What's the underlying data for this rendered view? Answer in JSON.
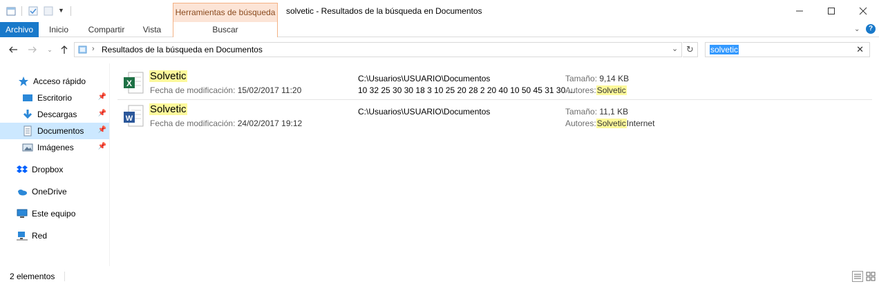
{
  "window": {
    "title": "solvetic - Resultados de la búsqueda en Documentos",
    "contextual_tab_group": "Herramientas de búsqueda"
  },
  "ribbon": {
    "tabs": [
      "Archivo",
      "Inicio",
      "Compartir",
      "Vista",
      "Buscar"
    ]
  },
  "address": {
    "path": "Resultados de la búsqueda en Documentos",
    "search_value": "solvetic"
  },
  "nav": {
    "items": [
      {
        "label": "Acceso rápido",
        "icon": "star-icon"
      },
      {
        "label": "Escritorio",
        "icon": "desktop-icon",
        "pinned": true
      },
      {
        "label": "Descargas",
        "icon": "download-icon",
        "pinned": true
      },
      {
        "label": "Documentos",
        "icon": "documents-icon",
        "pinned": true,
        "selected": true
      },
      {
        "label": "Imágenes",
        "icon": "pictures-icon",
        "pinned": true
      },
      {
        "label": "Dropbox",
        "icon": "dropbox-icon"
      },
      {
        "label": "OneDrive",
        "icon": "onedrive-icon"
      },
      {
        "label": "Este equipo",
        "icon": "computer-icon"
      },
      {
        "label": "Red",
        "icon": "network-icon"
      }
    ]
  },
  "results": [
    {
      "name": "Solvetic",
      "type_icon": "excel-file-icon",
      "modified_label": "Fecha de modificación:",
      "modified": "15/02/2017 11:20",
      "folder": "C:\\Usuarios\\USUARIO\\Documentos",
      "preview": "10 32 25 30 30 18 3 10 25 20 28 2 20 40 10 50 45 31 30 ...",
      "size_label": "Tamaño:",
      "size": "9,14 KB",
      "authors_label": "Autores:",
      "authors_highlight": "Solvetic",
      "authors_rest": ""
    },
    {
      "name": "Solvetic",
      "type_icon": "word-file-icon",
      "modified_label": "Fecha de modificación:",
      "modified": "24/02/2017 19:12",
      "folder": "C:\\Usuarios\\USUARIO\\Documentos",
      "preview": "",
      "size_label": "Tamaño:",
      "size": "11,1 KB",
      "authors_label": "Autores:",
      "authors_highlight": "Solvetic",
      "authors_rest": "Internet"
    }
  ],
  "status": {
    "count": "2 elementos"
  },
  "colors": {
    "file_tab": "#1979ca",
    "contextual_tab": "#fce4d6",
    "highlight": "#fdf99b",
    "selection": "#cce8ff"
  }
}
